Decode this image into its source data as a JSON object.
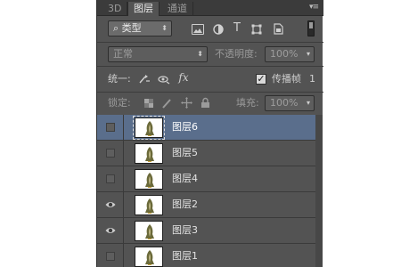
{
  "tabs": [
    {
      "label": "3D",
      "active": false
    },
    {
      "label": "图层",
      "active": true
    },
    {
      "label": "通道",
      "active": false
    }
  ],
  "panel_menu_icon": "panel-menu-icon",
  "filter": {
    "kind_label": "类型",
    "icons": [
      "image-filter-icon",
      "adjustment-filter-icon",
      "type-filter-icon",
      "shape-filter-icon",
      "smart-object-filter-icon",
      "filter-toggle-icon"
    ],
    "type_glyph": "T"
  },
  "blend": {
    "mode": "正常",
    "opacity_label": "不透明度:",
    "opacity_value": "100%"
  },
  "unify": {
    "label": "统一:",
    "icons": [
      "unify-position-icon",
      "unify-visibility-icon",
      "unify-style-icon"
    ],
    "fx_glyph": "fx",
    "propagate_label": "传播帧",
    "propagate_checked": true,
    "frame_number": "1"
  },
  "lock": {
    "label": "锁定:",
    "icons": [
      "lock-transparent-icon",
      "lock-paint-icon",
      "lock-move-icon",
      "lock-all-icon"
    ],
    "fill_label": "填充:",
    "fill_value": "100%"
  },
  "layers": [
    {
      "name": "图层6",
      "visible": false,
      "selected": true
    },
    {
      "name": "图层5",
      "visible": false,
      "selected": false
    },
    {
      "name": "图层4",
      "visible": false,
      "selected": false
    },
    {
      "name": "图层2",
      "visible": true,
      "selected": false
    },
    {
      "name": "图层3",
      "visible": true,
      "selected": false
    },
    {
      "name": "图层1",
      "visible": false,
      "selected": false
    }
  ],
  "colors": {
    "panel_bg": "#535353",
    "selected_row": "#5a6e8c"
  }
}
